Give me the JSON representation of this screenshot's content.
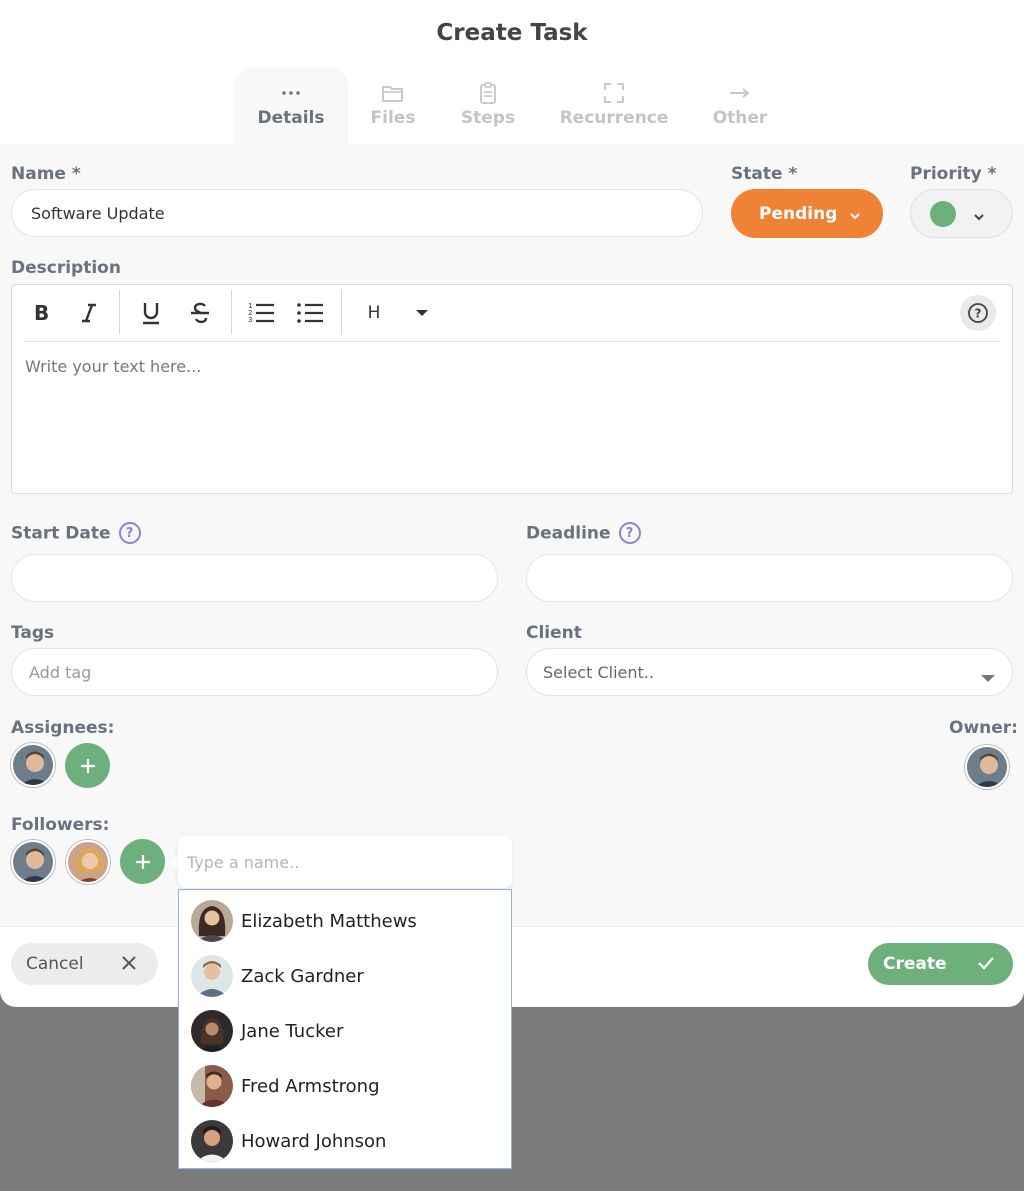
{
  "dialog": {
    "title": "Create Task"
  },
  "tabs": [
    {
      "label": "Details",
      "icon": "dots-icon"
    },
    {
      "label": "Files",
      "icon": "folder-icon"
    },
    {
      "label": "Steps",
      "icon": "clipboard-icon"
    },
    {
      "label": "Recurrence",
      "icon": "expand-icon"
    },
    {
      "label": "Other",
      "icon": "arrow-right-icon"
    }
  ],
  "form": {
    "name_label": "Name *",
    "name_value": "Software Update",
    "state_label": "State *",
    "state_value": "Pending",
    "priority_label": "Priority *",
    "description_label": "Description",
    "description_placeholder": "Write your text here...",
    "toolbar": {
      "heading": "H"
    },
    "start_date_label": "Start Date",
    "deadline_label": "Deadline",
    "tags_label": "Tags",
    "tags_placeholder": "Add tag",
    "client_label": "Client",
    "client_placeholder": "Select Client..",
    "assignees_label": "Assignees:",
    "owner_label": "Owner:",
    "followers_label": "Followers:"
  },
  "follower_search": {
    "placeholder": "Type a name..",
    "suggestions": [
      {
        "name": "Elizabeth Matthews"
      },
      {
        "name": "Zack Gardner"
      },
      {
        "name": "Jane Tucker"
      },
      {
        "name": "Fred Armstrong"
      },
      {
        "name": "Howard Johnson"
      }
    ]
  },
  "footer": {
    "cancel_label": "Cancel",
    "create_label": "Create"
  },
  "colors": {
    "state_pending": "#ef8235",
    "priority": "#6db07c",
    "accent_green": "#6db07c",
    "help_purple": "#8d82d6"
  }
}
